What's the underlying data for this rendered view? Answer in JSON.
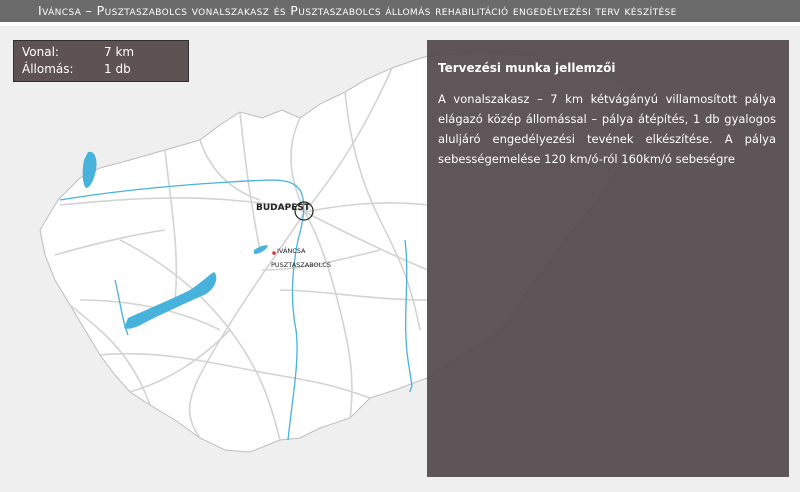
{
  "header": {
    "title": "Iváncsa – Pusztaszabolcs vonalszakasz és Pusztaszabolcs állomás rehabilitáció engedélyezési terv készítése"
  },
  "stats": [
    {
      "label": "Vonal:",
      "value": "7 km"
    },
    {
      "label": "Állomás:",
      "value": "1 db"
    }
  ],
  "map": {
    "labels": {
      "capital": "BUDAPEST",
      "site_line1": "IVÁNCSA",
      "site_line2": "PUSZTASZABOLCS"
    },
    "colors": {
      "land": "#ffffff",
      "water": "#47b2dc",
      "rail": "#d3d3d3",
      "background": "#efefef"
    }
  },
  "info_panel": {
    "title": "Tervezési munka jellemzői",
    "body": "A vonalszakasz – 7 km kétvágányú villamosított pálya elágazó közép állomással – pálya átépítés, 1 db gyalogos aluljáró engedélyezési tevének elkészítése. A pálya sebességemelése 120 km/ó-ról 160km/ó sebeségre"
  }
}
